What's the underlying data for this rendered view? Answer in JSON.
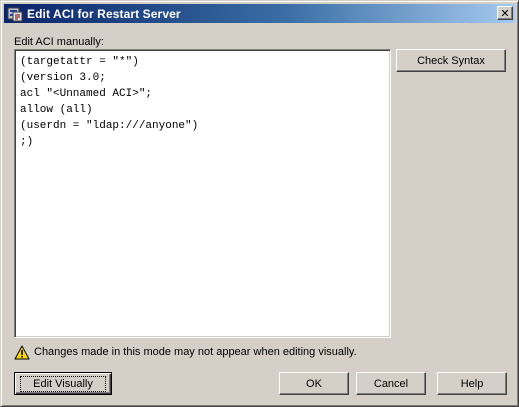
{
  "window": {
    "title": "Edit ACI for Restart Server",
    "close_glyph": "✕",
    "icon": "directory-server-icon"
  },
  "editor": {
    "label": "Edit ACI manually:",
    "lines": [
      "(targetattr = \"*\")",
      "(version 3.0;",
      "acl \"<Unnamed ACI>\";",
      "allow (all)",
      "(userdn = \"ldap:///anyone\")",
      ";)"
    ]
  },
  "buttons": {
    "check_syntax": "Check Syntax",
    "edit_visually": "Edit Visually",
    "ok": "OK",
    "cancel": "Cancel",
    "help": "Help"
  },
  "warning": {
    "icon": "warning-icon",
    "text": "Changes made in this mode may not appear when editing visually."
  },
  "colors": {
    "titlebar_start": "#0a246a",
    "titlebar_end": "#a6caf0",
    "dialog_face": "#d4d0c8"
  }
}
